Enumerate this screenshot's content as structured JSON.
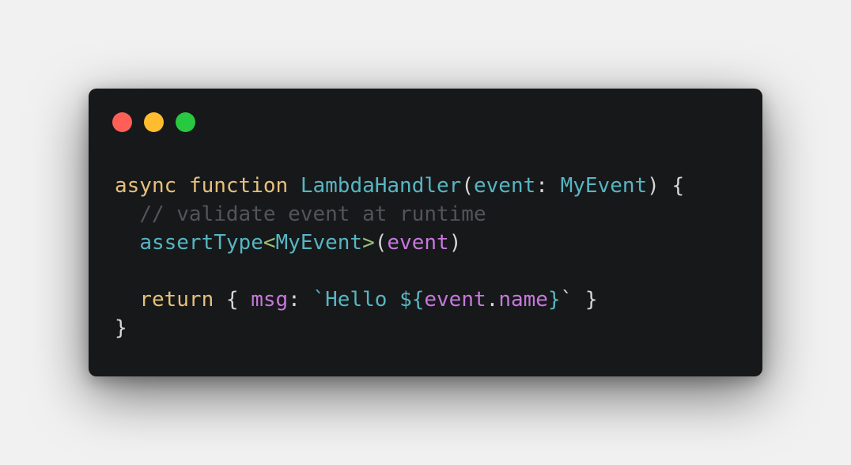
{
  "window": {
    "controls": [
      {
        "name": "close",
        "color": "#ff5f57"
      },
      {
        "name": "minimize",
        "color": "#febc2e"
      },
      {
        "name": "maximize",
        "color": "#28c840"
      }
    ]
  },
  "colors": {
    "window_bg": "#17181a",
    "keyword": "#e5c07b",
    "function": "#56b6c2",
    "type": "#56b6c2",
    "param": "#56b6c2",
    "punct": "#d6d6d6",
    "comment": "#4f5659",
    "generic_bracket": "#98c379",
    "variable": "#c678dd",
    "string": "#56b6c2"
  },
  "code": {
    "lines": [
      [
        {
          "text": "async",
          "kind": "keyword"
        },
        {
          "text": " ",
          "kind": "punct"
        },
        {
          "text": "function",
          "kind": "keyword"
        },
        {
          "text": " ",
          "kind": "punct"
        },
        {
          "text": "LambdaHandler",
          "kind": "function"
        },
        {
          "text": "(",
          "kind": "punct"
        },
        {
          "text": "event",
          "kind": "param"
        },
        {
          "text": ": ",
          "kind": "punct"
        },
        {
          "text": "MyEvent",
          "kind": "type"
        },
        {
          "text": ") {",
          "kind": "punct"
        }
      ],
      [
        {
          "text": "  ",
          "kind": "punct"
        },
        {
          "text": "// validate event at runtime",
          "kind": "comment"
        }
      ],
      [
        {
          "text": "  ",
          "kind": "punct"
        },
        {
          "text": "assertType",
          "kind": "function"
        },
        {
          "text": "<",
          "kind": "generic_bracket"
        },
        {
          "text": "MyEvent",
          "kind": "type"
        },
        {
          "text": ">",
          "kind": "generic_bracket"
        },
        {
          "text": "(",
          "kind": "punct"
        },
        {
          "text": "event",
          "kind": "variable"
        },
        {
          "text": ")",
          "kind": "punct"
        }
      ],
      [],
      [
        {
          "text": "  ",
          "kind": "punct"
        },
        {
          "text": "return",
          "kind": "keyword"
        },
        {
          "text": " { ",
          "kind": "punct"
        },
        {
          "text": "msg",
          "kind": "variable"
        },
        {
          "text": ": ",
          "kind": "punct"
        },
        {
          "text": "`Hello ",
          "kind": "string"
        },
        {
          "text": "${",
          "kind": "string"
        },
        {
          "text": "event",
          "kind": "variable"
        },
        {
          "text": ".",
          "kind": "punct"
        },
        {
          "text": "name",
          "kind": "variable"
        },
        {
          "text": "}",
          "kind": "string"
        },
        {
          "text": "`",
          "kind": "punct"
        },
        {
          "text": " }",
          "kind": "punct"
        }
      ],
      [
        {
          "text": "}",
          "kind": "punct"
        }
      ]
    ]
  }
}
